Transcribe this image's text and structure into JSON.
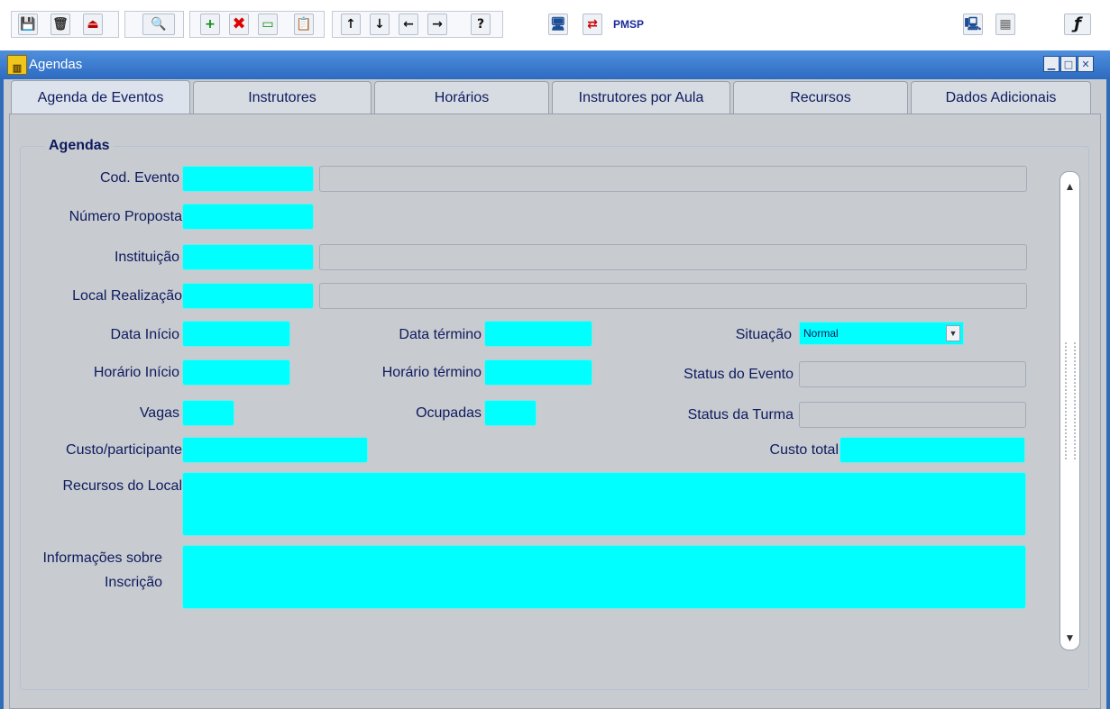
{
  "toolbar": {
    "pmsp_label": "PMSP",
    "buttons": [
      {
        "name": "save-icon",
        "glyph": "💾"
      },
      {
        "name": "delete-icon",
        "glyph": "🗑"
      },
      {
        "name": "exit-icon",
        "glyph": "⏏"
      },
      {
        "name": "query-icon",
        "glyph": "🔍"
      },
      {
        "name": "insert-record-icon",
        "glyph": "+"
      },
      {
        "name": "delete-record-icon",
        "glyph": "✖"
      },
      {
        "name": "clear-icon",
        "glyph": "▭"
      },
      {
        "name": "clipboard-icon",
        "glyph": "📋"
      },
      {
        "name": "first-record-icon",
        "glyph": "↑"
      },
      {
        "name": "last-record-icon",
        "glyph": "↓"
      },
      {
        "name": "previous-icon",
        "glyph": "←"
      },
      {
        "name": "next-icon",
        "glyph": "→"
      },
      {
        "name": "help-icon",
        "glyph": "?"
      },
      {
        "name": "window-icon",
        "glyph": "🖥"
      },
      {
        "name": "refresh-icon",
        "glyph": "⇄"
      },
      {
        "name": "computer-icon",
        "glyph": "🖳"
      },
      {
        "name": "grid-icon",
        "glyph": "▦"
      },
      {
        "name": "function-icon",
        "glyph": "ƒ"
      }
    ]
  },
  "window": {
    "title": "Agendas",
    "icon": "building-icon"
  },
  "tabs": [
    {
      "label": "Agenda de Eventos",
      "active": true
    },
    {
      "label": "Instrutores",
      "active": false
    },
    {
      "label": "Horários",
      "active": false
    },
    {
      "label": "Instrutores por Aula",
      "active": false
    },
    {
      "label": "Recursos",
      "active": false
    },
    {
      "label": "Dados Adicionais",
      "active": false
    }
  ],
  "form": {
    "group_title": "Agendas",
    "labels": {
      "cod_evento": "Cod. Evento",
      "numero_proposta": "Número Proposta",
      "instituicao": "Instituição",
      "local_realizacao": "Local Realização",
      "data_inicio": "Data Início",
      "data_termino": "Data término",
      "situacao": "Situação",
      "horario_inicio": "Horário Início",
      "horario_termino": "Horário término",
      "status_evento": "Status do Evento",
      "vagas": "Vagas",
      "ocupadas": "Ocupadas",
      "status_turma": "Status da Turma",
      "custo_participante": "Custo/participante",
      "custo_total": "Custo total",
      "recursos_local": "Recursos do Local",
      "informacoes_inscricao_1": "Informações sobre",
      "informacoes_inscricao_2": "Inscrição"
    },
    "situacao_value": "Normal"
  },
  "colors": {
    "field_active": "#00ffff",
    "titlebar": "#2c6bc0",
    "canvas": "#c8cbd0"
  }
}
